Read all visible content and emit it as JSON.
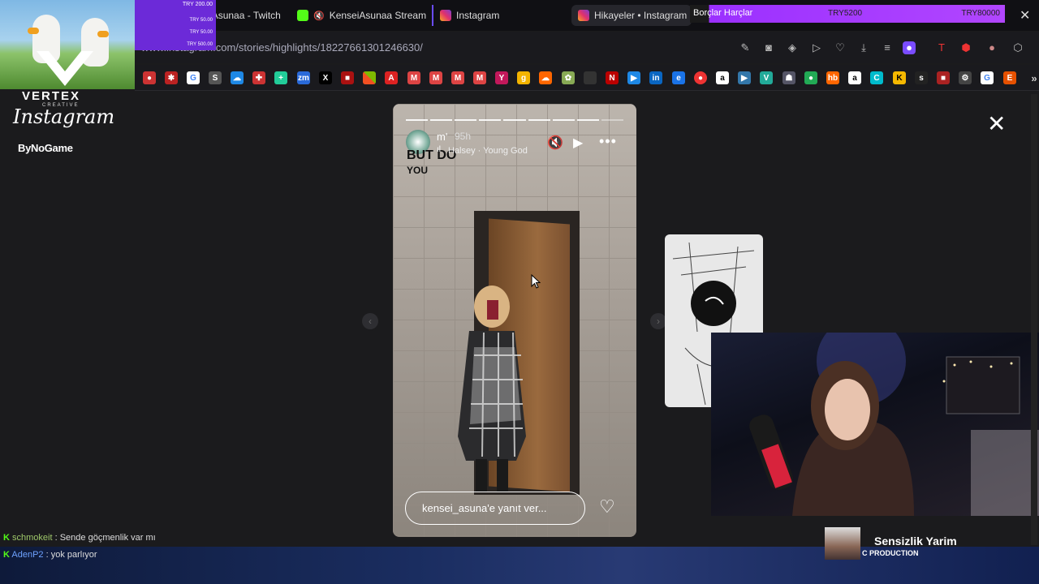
{
  "tabs": [
    {
      "label": "KenseiAsunaa - Twitch",
      "icon": "twitch-icon"
    },
    {
      "label": "KenseiAsunaa Stream",
      "icon": "kick-icon"
    },
    {
      "label": "Instagram",
      "icon": "instagram-icon"
    },
    {
      "label": "Hikayeler • Instagram",
      "icon": "instagram-icon"
    }
  ],
  "address": {
    "url": "www.instagram.com/stories/highlights/18227661301246630/"
  },
  "overlay": {
    "vertex": "VERTEX",
    "creative": "CREATIVE",
    "instagram_logo": "Instagram",
    "bynogame": "ByNoGame",
    "donations": [
      "TRY 200.00",
      "TRY 50.00",
      "TRY 50.00",
      "TRY 500.00"
    ],
    "borclar": {
      "label": "Borçlar Harçlar",
      "current": "TRY5200",
      "goal": "TRY80000"
    }
  },
  "story": {
    "username": "m'",
    "time": "95h",
    "song": "Halsey · Young God",
    "caption_top": "BUT DO",
    "caption_bottom": "YOU",
    "reply_placeholder": "kensei_asuna'e yanıt ver...",
    "progress_segments": 9,
    "progress_active": 8
  },
  "chat": [
    {
      "user": "schmokeit",
      "user_color": "#9fc86a",
      "message": ": Sende göçmenlik var mı"
    },
    {
      "user": "AdenP2",
      "user_color": "#6ea2ff",
      "message": ": yok parlıyor"
    }
  ],
  "now_playing": {
    "title": "Sensizlik Yarim",
    "label": "C PRODUCTION"
  },
  "colors": {
    "kick_green": "#53fc18",
    "twitch_purple": "#9146ff",
    "ig_pink": "#e1306c"
  }
}
